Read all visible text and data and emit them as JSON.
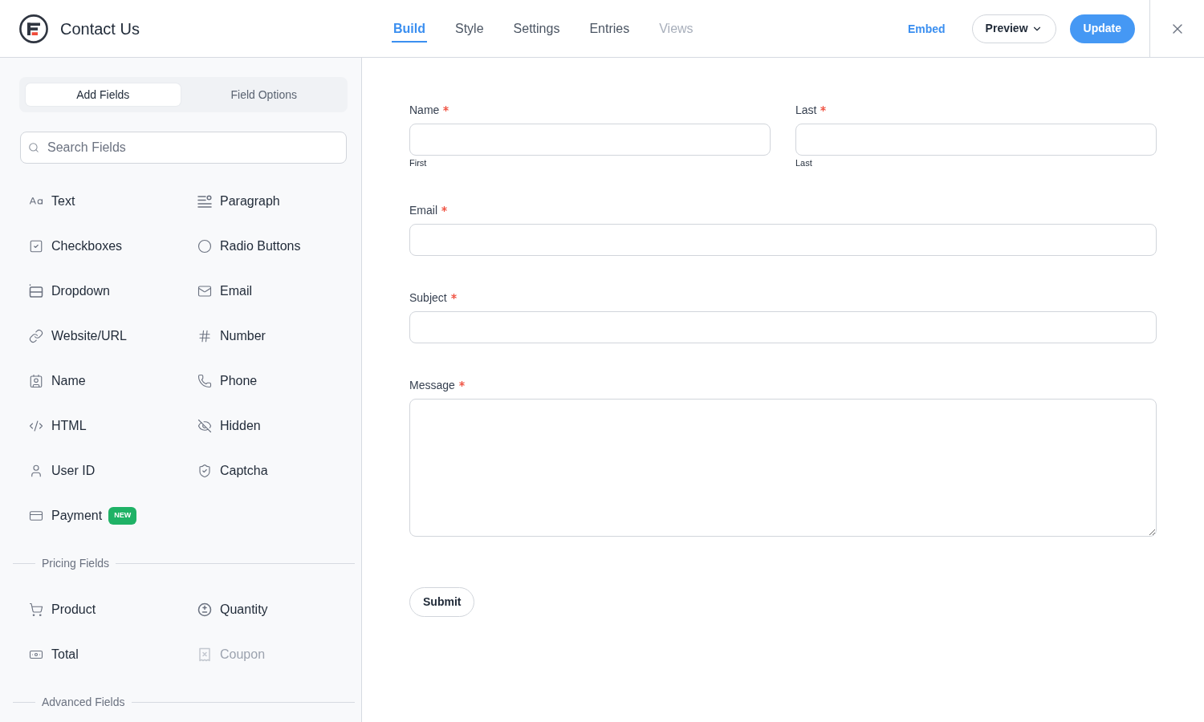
{
  "header": {
    "title": "Contact Us",
    "tabs": [
      {
        "label": "Build",
        "selected": true,
        "disabled": false
      },
      {
        "label": "Style",
        "selected": false,
        "disabled": false
      },
      {
        "label": "Settings",
        "selected": false,
        "disabled": false
      },
      {
        "label": "Entries",
        "selected": false,
        "disabled": false
      },
      {
        "label": "Views",
        "selected": false,
        "disabled": true
      }
    ],
    "actions": {
      "embed": "Embed",
      "preview": "Preview",
      "update": "Update"
    }
  },
  "sidebar": {
    "modes": [
      {
        "label": "Add Fields",
        "selected": true
      },
      {
        "label": "Field Options",
        "selected": false
      }
    ],
    "search": {
      "placeholder": "Search Fields"
    },
    "fields": [
      {
        "label": "Text",
        "disabled": false
      },
      {
        "label": "Paragraph",
        "disabled": false
      },
      {
        "label": "Checkboxes",
        "disabled": false
      },
      {
        "label": "Radio Buttons",
        "disabled": false
      },
      {
        "label": "Dropdown",
        "disabled": false
      },
      {
        "label": "Email",
        "disabled": false
      },
      {
        "label": "Website/URL",
        "disabled": false
      },
      {
        "label": "Number",
        "disabled": false
      },
      {
        "label": "Name",
        "disabled": false
      },
      {
        "label": "Phone",
        "disabled": false
      },
      {
        "label": "HTML",
        "disabled": false
      },
      {
        "label": "Hidden",
        "disabled": false
      },
      {
        "label": "User ID",
        "disabled": false
      },
      {
        "label": "Captcha",
        "disabled": false
      },
      {
        "label": "Payment",
        "disabled": false,
        "badge": "NEW"
      }
    ],
    "sections": [
      {
        "title": "Pricing Fields",
        "fields": [
          {
            "label": "Product",
            "disabled": false
          },
          {
            "label": "Quantity",
            "disabled": false
          },
          {
            "label": "Total",
            "disabled": false
          },
          {
            "label": "Coupon",
            "disabled": true
          }
        ]
      },
      {
        "title": "Advanced Fields"
      }
    ]
  },
  "form": {
    "rows": [
      {
        "fields": [
          {
            "kind": "input",
            "label": "Name",
            "required": true,
            "sublabel": "First"
          },
          {
            "kind": "input",
            "label": "Last",
            "required": true,
            "sublabel": "Last"
          }
        ]
      },
      {
        "fields": [
          {
            "kind": "input",
            "label": "Email",
            "required": true
          }
        ]
      },
      {
        "fields": [
          {
            "kind": "input",
            "label": "Subject",
            "required": true
          }
        ]
      },
      {
        "fields": [
          {
            "kind": "textarea",
            "label": "Message",
            "required": true
          }
        ]
      }
    ],
    "submit": "Submit"
  }
}
